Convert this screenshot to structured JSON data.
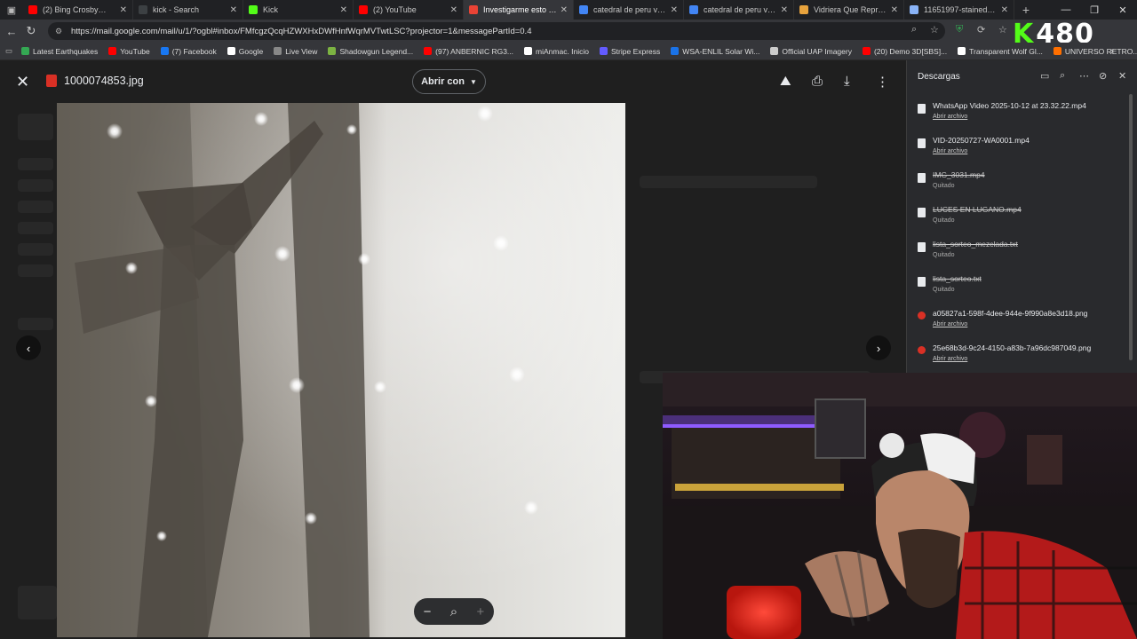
{
  "tabs": [
    {
      "title": "(2) Bing Crosby💔 Best",
      "favicon_color": "#ff0000",
      "active": false
    },
    {
      "title": "kick - Search",
      "favicon_color": "#3c4043",
      "active": false
    },
    {
      "title": "Kick",
      "favicon_color": "#53fc18",
      "active": false
    },
    {
      "title": "(2) YouTube",
      "favicon_color": "#ff0000",
      "active": false
    },
    {
      "title": "Investigarme esto lobo",
      "favicon_color": "#ea4335",
      "active": true
    },
    {
      "title": "catedral de peru vitrale",
      "favicon_color": "#4285f4",
      "active": false
    },
    {
      "title": "catedral de peru vitrale",
      "favicon_color": "#4285f4",
      "active": false
    },
    {
      "title": "Vidriera Que Represent",
      "favicon_color": "#e8a33d",
      "active": false
    },
    {
      "title": "11651997-stained-glas",
      "favicon_color": "#8ab4f8",
      "active": false
    }
  ],
  "address_bar": {
    "url": "https://mail.google.com/mail/u/1/?ogbl#inbox/FMfcgzQcqHZWXHxDWfHnfWqrMVTwtLSC?projector=1&messagePartId=0.4"
  },
  "bookmarks": [
    {
      "label": "Latest Earthquakes",
      "color": "#34a853"
    },
    {
      "label": "YouTube",
      "color": "#ff0000"
    },
    {
      "label": "(7) Facebook",
      "color": "#1877f2"
    },
    {
      "label": "Google",
      "color": "#ffffff"
    },
    {
      "label": "Live View",
      "color": "#888888"
    },
    {
      "label": "Shadowgun Legend...",
      "color": "#7cb342"
    },
    {
      "label": "(97) ANBERNIC RG3...",
      "color": "#ff0000"
    },
    {
      "label": "miAnmac. Inicio",
      "color": "#ffffff"
    },
    {
      "label": "Stripe Express",
      "color": "#635bff"
    },
    {
      "label": "WSA-ENLIL Solar Wi...",
      "color": "#1a73e8"
    },
    {
      "label": "Official UAP Imagery",
      "color": "#cccccc"
    },
    {
      "label": "(20) Demo 3D[SBS]...",
      "color": "#ff0000"
    },
    {
      "label": "Transparent Wolf Gl...",
      "color": "#ffffff"
    },
    {
      "label": "UNIVERSO RETRO...",
      "color": "#ff6f00"
    }
  ],
  "overlay_logo": {
    "k": "K",
    "text": "480"
  },
  "viewer": {
    "filename": "1000074853.jpg",
    "open_with": "Abrir con"
  },
  "downloads": {
    "title": "Descargas",
    "items": [
      {
        "name": "WhatsApp Video 2025-10-12 at 23.32.22.mp4",
        "status": "Abrir archivo",
        "deleted": false,
        "type": "file"
      },
      {
        "name": "VID-20250727-WA0001.mp4",
        "status": "Abrir archivo",
        "deleted": false,
        "type": "file"
      },
      {
        "name": "IMG_3031.mp4",
        "status": "Quitado",
        "deleted": true,
        "type": "file"
      },
      {
        "name": "LUCES EN LUGANO.mp4",
        "status": "Quitado",
        "deleted": true,
        "type": "file"
      },
      {
        "name": "lista_sorteo_mezclada.txt",
        "status": "Quitado",
        "deleted": true,
        "type": "file"
      },
      {
        "name": "lista_sorteo.txt",
        "status": "Quitado",
        "deleted": true,
        "type": "file"
      },
      {
        "name": "a05827a1-598f-4dee-944e-9f990a8e3d18.png",
        "status": "Abrir archivo",
        "deleted": false,
        "type": "png"
      },
      {
        "name": "25e68b3d-9c24-4150-a83b-7a96dc987049.png",
        "status": "Abrir archivo",
        "deleted": false,
        "type": "png"
      }
    ]
  },
  "colors": {
    "accent_kick": "#53fc18",
    "viewer_bg": "#1f1f1f",
    "panel_bg": "#292a2d"
  }
}
